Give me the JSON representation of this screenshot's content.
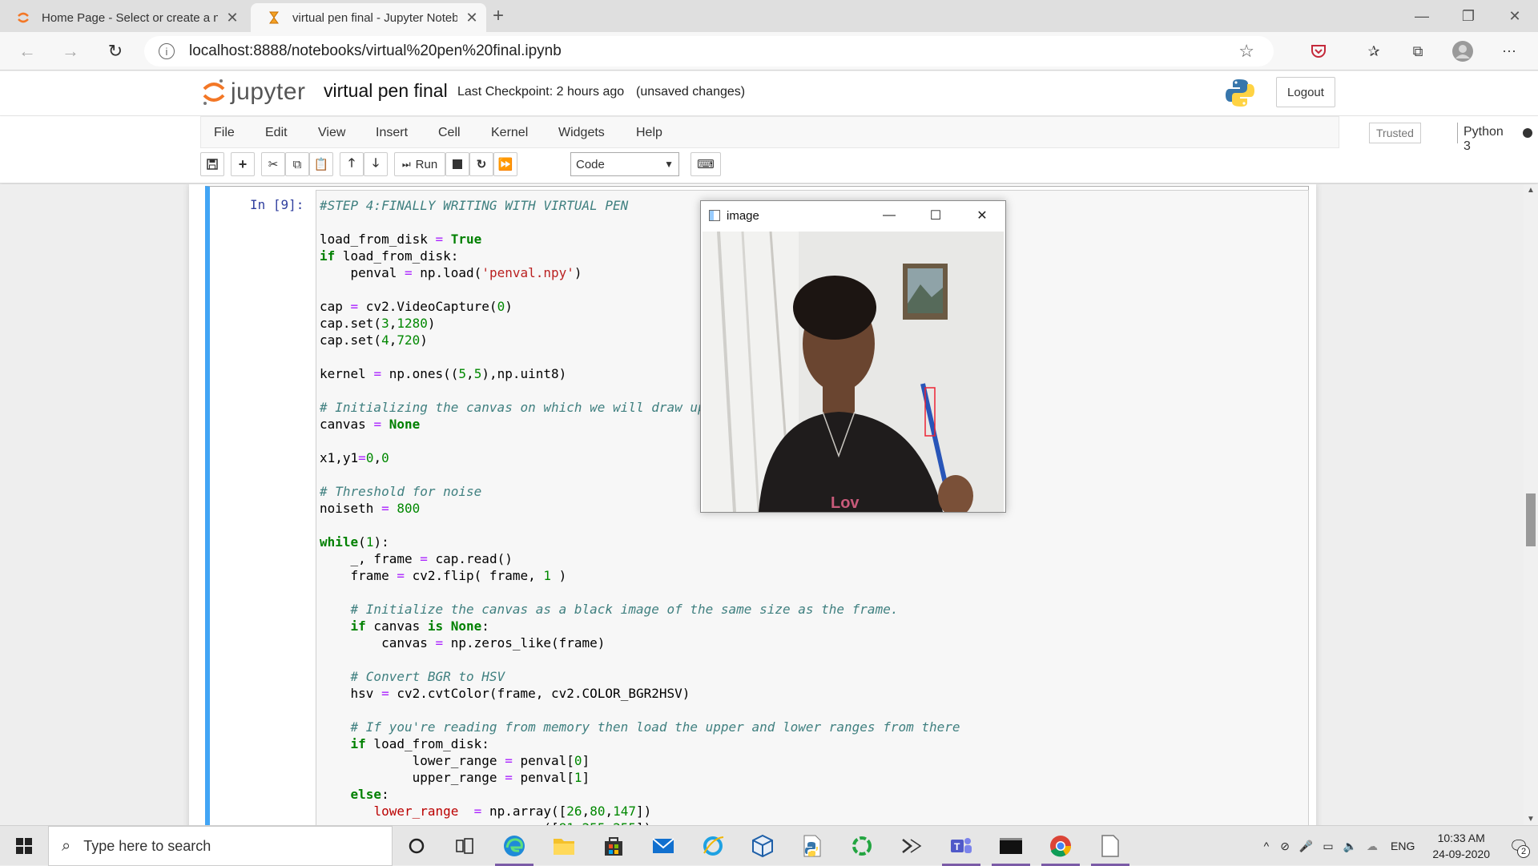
{
  "browser": {
    "tabs": [
      {
        "title": "Home Page - Select or create a n",
        "active": false
      },
      {
        "title": "virtual pen final - Jupyter Noteb",
        "active": true
      }
    ],
    "url": "localhost:8888/notebooks/virtual%20pen%20final.ipynb"
  },
  "jupyter": {
    "logo_text": "jupyter",
    "notebook_name": "virtual pen final",
    "checkpoint": "Last Checkpoint: 2 hours ago",
    "status": "(unsaved changes)",
    "logout_label": "Logout",
    "menu": [
      "File",
      "Edit",
      "View",
      "Insert",
      "Cell",
      "Kernel",
      "Widgets",
      "Help"
    ],
    "trusted_label": "Trusted",
    "kernel_name": "Python 3",
    "run_label": "Run",
    "cell_type": "Code"
  },
  "cell": {
    "prompt": "In [9]:"
  },
  "image_window": {
    "title": "image"
  },
  "taskbar": {
    "search_placeholder": "Type here to search",
    "language": "ENG",
    "time": "10:33 AM",
    "date": "24-09-2020",
    "notification_count": "2"
  },
  "colors": {
    "cell_accent": "#42a5f5",
    "prompt": "#303f9f",
    "comment": "#408080",
    "keyword": "#008000",
    "string": "#ba2121"
  }
}
